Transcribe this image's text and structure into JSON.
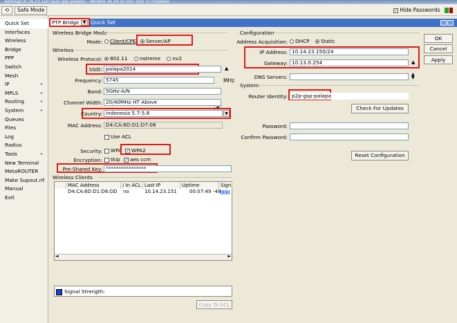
{
  "window": {
    "title": "admin@10.14.23.150 (p2p-gsp-palapa) - WinBox v6.34 on SXT 5nD r2 (mipsbe)"
  },
  "toolbar": {
    "undo_icon": "undo-icon",
    "safe_mode": "Safe Mode",
    "hide_passwords_label": "Hide Passwords",
    "hide_passwords_checked": true
  },
  "sidebar": {
    "items": [
      {
        "label": "Quick Set",
        "arrow": false
      },
      {
        "label": "Interfaces",
        "arrow": false
      },
      {
        "label": "Wireless",
        "arrow": false
      },
      {
        "label": "Bridge",
        "arrow": false
      },
      {
        "label": "PPP",
        "arrow": false
      },
      {
        "label": "Switch",
        "arrow": false
      },
      {
        "label": "Mesh",
        "arrow": false
      },
      {
        "label": "IP",
        "arrow": true
      },
      {
        "label": "MPLS",
        "arrow": true
      },
      {
        "label": "Routing",
        "arrow": true
      },
      {
        "label": "System",
        "arrow": true
      },
      {
        "label": "Queues",
        "arrow": false
      },
      {
        "label": "Files",
        "arrow": false
      },
      {
        "label": "Log",
        "arrow": false
      },
      {
        "label": "Radius",
        "arrow": false
      },
      {
        "label": "Tools",
        "arrow": true
      },
      {
        "label": "New Terminal",
        "arrow": false
      },
      {
        "label": "MetaROUTER",
        "arrow": false
      },
      {
        "label": "Make Supout.rif",
        "arrow": false
      },
      {
        "label": "Manual",
        "arrow": false
      },
      {
        "label": "Exit",
        "arrow": false
      }
    ]
  },
  "quickset": {
    "mode_select": "PTP Bridge",
    "title": "Quick Set",
    "wbm": {
      "group": "Wireless Bridge Mode",
      "mode_label": "Mode:",
      "client_option": "Client/CPE",
      "server_option": "Server/AP",
      "selected": "Server/AP"
    },
    "wireless": {
      "group": "Wireless",
      "protocol_label": "Wireless Protocol:",
      "protocol_options": [
        "802.11",
        "nstreme",
        "nv2"
      ],
      "protocol_selected": "802.11",
      "ssid_label": "SSID:",
      "ssid": "palapa2014",
      "frequency_label": "Frequency:",
      "frequency": "5745",
      "frequency_unit": "MHz",
      "band_label": "Band:",
      "band": "5GHz-A/N",
      "channel_width_label": "Channel Width:",
      "channel_width": "20/40MHz HT Above",
      "country_label": "Country:",
      "country": "indonesia 5.7-5.8",
      "mac_label": "MAC Address:",
      "mac": "D4:CA:6D:D1:D7:06",
      "use_acl": "Use ACL",
      "security_label": "Security:",
      "wpa": "WPA",
      "wpa2": "WPA2",
      "encryption_label": "Encryption:",
      "tkip": "tkip",
      "aes": "aes ccm",
      "psk_label": "Pre-Shared Key:",
      "psk": "****************"
    },
    "clients": {
      "group": "Wireless Clients",
      "columns": [
        "MAC Address",
        "In ACL",
        "Last IP",
        "Uptime",
        "Signal"
      ],
      "rows": [
        {
          "mac": "D4:CA:6D:D1:D6:DD",
          "in_acl": "no",
          "last_ip": "10.14.23.151",
          "uptime": "00:07:49",
          "signal": "-48"
        }
      ],
      "legend": "Signal Strength:",
      "copy_to_acl": "Copy To ACL"
    },
    "configuration": {
      "group": "Configuration",
      "acq_label": "Address Acquisition:",
      "acq_options": [
        "DHCP",
        "Static"
      ],
      "acq_selected": "Static",
      "ip_label": "IP Address:",
      "ip": "10.14.23.150/24",
      "gateway_label": "Gateway:",
      "gateway": "10.13.0.254",
      "dns_label": "DNS Servers:",
      "dns": ""
    },
    "system": {
      "group": "System",
      "identity_label": "Router Identity:",
      "identity": "p2p-gsp-palapa",
      "check_updates": "Check For Updates",
      "password_label": "Password:",
      "confirm_label": "Confirm Password:",
      "reset_config": "Reset Configuration"
    },
    "buttons": {
      "ok": "OK",
      "cancel": "Cancel",
      "apply": "Apply"
    }
  }
}
